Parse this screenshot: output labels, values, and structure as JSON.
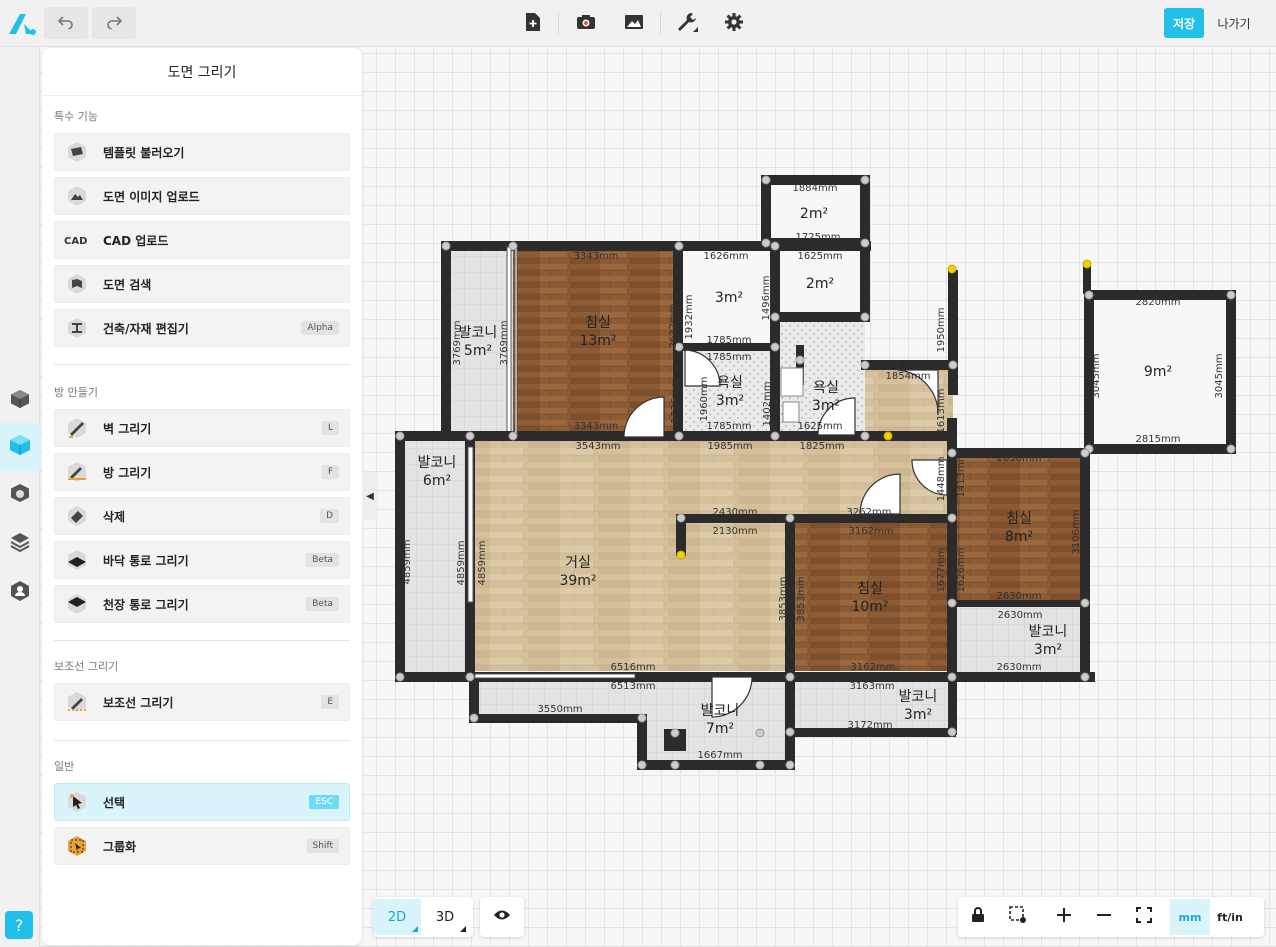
{
  "toolbar": {
    "save_label": "저장",
    "exit_label": "나가기"
  },
  "panel": {
    "title": "도면 그리기",
    "sections": [
      {
        "title": "특수 기능",
        "items": [
          {
            "label": "템플릿 불러오기",
            "badge": "",
            "icon": "template-box-icon"
          },
          {
            "label": "도면 이미지 업로드",
            "badge": "",
            "icon": "image-upload-icon"
          },
          {
            "label": "CAD 업로드",
            "badge": "",
            "icon": "cad-icon"
          },
          {
            "label": "도면 검색",
            "badge": "",
            "icon": "floor-search-icon"
          },
          {
            "label": "건축/자재 편집기",
            "badge": "Alpha",
            "icon": "beam-editor-icon"
          }
        ]
      },
      {
        "title": "방 만들기",
        "items": [
          {
            "label": "벽 그리기",
            "badge": "L",
            "icon": "wall-draw-icon"
          },
          {
            "label": "방 그리기",
            "badge": "F",
            "icon": "room-draw-icon"
          },
          {
            "label": "삭제",
            "badge": "D",
            "icon": "eraser-icon"
          },
          {
            "label": "바닥 통로 그리기",
            "badge": "Beta",
            "icon": "floor-passage-icon"
          },
          {
            "label": "천장 통로 그리기",
            "badge": "Beta",
            "icon": "ceiling-passage-icon"
          }
        ]
      },
      {
        "title": "보조선 그리기",
        "items": [
          {
            "label": "보조선 그리기",
            "badge": "E",
            "icon": "guide-line-icon"
          }
        ]
      },
      {
        "title": "일반",
        "items": [
          {
            "label": "선택",
            "badge": "ESC",
            "icon": "cursor-icon",
            "active": true
          },
          {
            "label": "그룹화",
            "badge": "Shift",
            "icon": "group-icon"
          }
        ]
      }
    ]
  },
  "help_label": "?",
  "view": {
    "mode_2d": "2D",
    "mode_3d": "3D"
  },
  "units": {
    "mm": "mm",
    "ftin": "ft/in"
  },
  "colors": {
    "accent": "#20c0ea",
    "wall": "#2b2b2b",
    "wood_dark": "#8b5a35",
    "wood_light": "#d6c2a0",
    "tile": "#dddddd"
  },
  "plan": {
    "rooms": [
      {
        "name": "발코니",
        "area": "5m²"
      },
      {
        "name": "침실",
        "area": "13m²"
      },
      {
        "name": "",
        "area": "3m²"
      },
      {
        "name": "",
        "area": "2m²"
      },
      {
        "name": "",
        "area": "2m²"
      },
      {
        "name": "욕실",
        "area": "3m²"
      },
      {
        "name": "욕실",
        "area": "3m²"
      },
      {
        "name": "",
        "area": "9m²"
      },
      {
        "name": "발코니",
        "area": "6m²"
      },
      {
        "name": "거실",
        "area": "39m²"
      },
      {
        "name": "침실",
        "area": "10m²"
      },
      {
        "name": "침실",
        "area": "8m²"
      },
      {
        "name": "발코니",
        "area": "3m²"
      },
      {
        "name": "발코니",
        "area": "7m²"
      },
      {
        "name": "발코니",
        "area": "3m²"
      }
    ],
    "dimensions": [
      "1884mm",
      "1725mm",
      "3343mm",
      "1626mm",
      "1625mm",
      "2820mm",
      "3769mm",
      "3769mm",
      "2632mm",
      "1932mm",
      "1496mm",
      "1785mm",
      "1785mm",
      "1950mm",
      "3045mm",
      "3045mm",
      "1854mm",
      "1960mm",
      "1736mm",
      "1402mm",
      "1613mm",
      "3343mm",
      "1785mm",
      "1625mm",
      "2815mm",
      "3543mm",
      "1985mm",
      "1825mm",
      "2630mm",
      "2430mm",
      "2130mm",
      "3262mm",
      "3162mm",
      "1448mm",
      "1413mm",
      "3106mm",
      "4859mm",
      "4859mm",
      "4859mm",
      "3853mm",
      "3853mm",
      "1677mm",
      "1626mm",
      "2630mm",
      "2630mm",
      "6516mm",
      "3162mm",
      "2630mm",
      "6513mm",
      "3163mm",
      "3550mm",
      "3172mm",
      "1667mm"
    ]
  }
}
